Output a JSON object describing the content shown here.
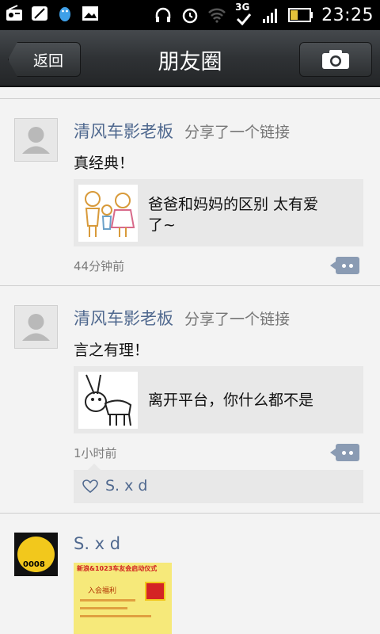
{
  "status_bar": {
    "time": "23:25",
    "network": "3G"
  },
  "nav": {
    "back_label": "返回",
    "title": "朋友圈"
  },
  "posts": [
    {
      "name": "清风车影老板",
      "action": "分享了一个链接",
      "text": "真经典！",
      "link_title_line1": "爸爸和妈妈的区别 太有爱",
      "link_title_line2": "了~",
      "time": "44分钟前"
    },
    {
      "name": "清风车影老板",
      "action": "分享了一个链接",
      "text": "言之有理！",
      "link_title_line1": "离开平台，你什么都不是",
      "time": "1小时前",
      "likes": "S. x d"
    },
    {
      "name": "S. x d",
      "avatar_text": "0008",
      "image_title": "新浪&1023车友会启动仪式",
      "image_caption": "入会福利"
    }
  ],
  "colors": {
    "name_link": "#50698f",
    "nav_bg": "#2f3235"
  }
}
